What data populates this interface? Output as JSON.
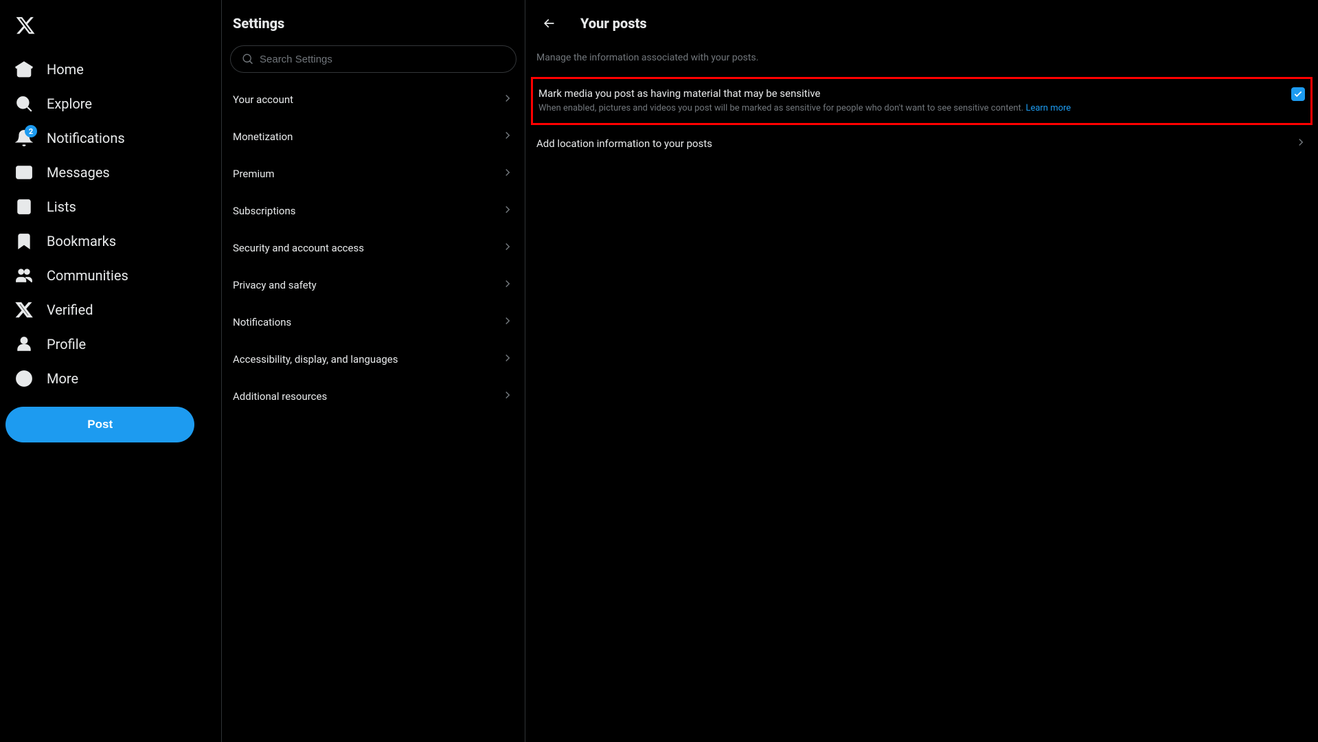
{
  "sidebar": {
    "items": [
      {
        "label": "Home",
        "icon": "home"
      },
      {
        "label": "Explore",
        "icon": "search"
      },
      {
        "label": "Notifications",
        "icon": "bell",
        "badge": "2"
      },
      {
        "label": "Messages",
        "icon": "mail"
      },
      {
        "label": "Lists",
        "icon": "list"
      },
      {
        "label": "Bookmarks",
        "icon": "bookmark"
      },
      {
        "label": "Communities",
        "icon": "people"
      },
      {
        "label": "Verified",
        "icon": "x"
      },
      {
        "label": "Profile",
        "icon": "person"
      },
      {
        "label": "More",
        "icon": "more"
      }
    ],
    "post_label": "Post"
  },
  "settings": {
    "title": "Settings",
    "search_placeholder": "Search Settings",
    "items": [
      "Your account",
      "Monetization",
      "Premium",
      "Subscriptions",
      "Security and account access",
      "Privacy and safety",
      "Notifications",
      "Accessibility, display, and languages",
      "Additional resources"
    ]
  },
  "detail": {
    "title": "Your posts",
    "description": "Manage the information associated with your posts.",
    "sensitive": {
      "title": "Mark media you post as having material that may be sensitive",
      "subtitle": "When enabled, pictures and videos you post will be marked as sensitive for people who don't want to see sensitive content. ",
      "learn_more": "Learn more",
      "checked": true
    },
    "location_label": "Add location information to your posts"
  }
}
